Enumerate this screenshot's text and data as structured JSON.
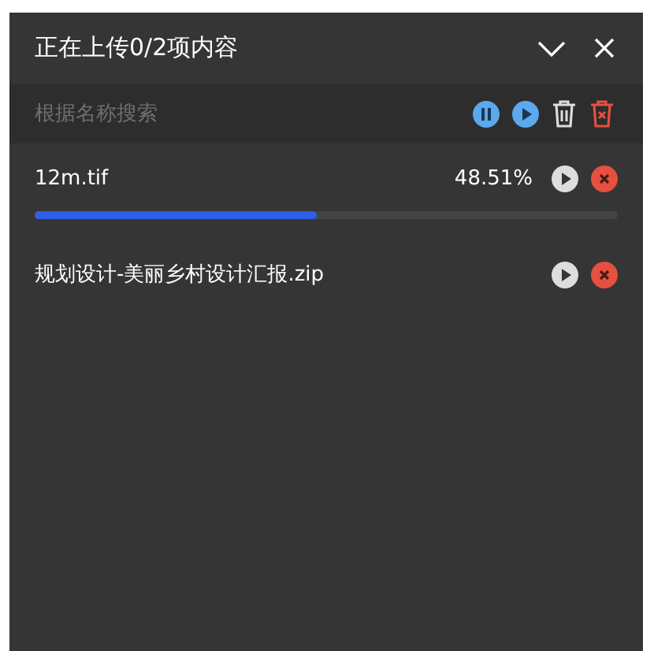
{
  "header": {
    "title": "正在上传0/2项内容"
  },
  "search": {
    "placeholder": "根据名称搜索"
  },
  "files": [
    {
      "name": "12m.tif",
      "percent": "48.51%",
      "level": 0.4851
    },
    {
      "name": "规划设计-美丽乡村设计汇报.zip"
    }
  ]
}
